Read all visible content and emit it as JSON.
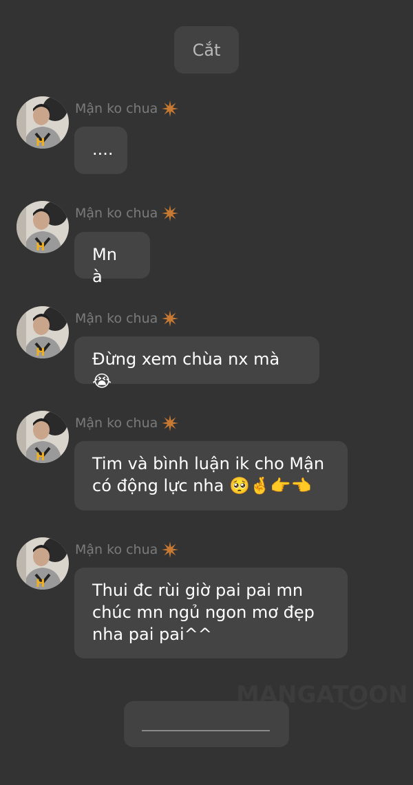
{
  "top_chip": {
    "label": "Cắt"
  },
  "messages": [
    {
      "sender": "Mận ko chua",
      "lines": [
        "...."
      ]
    },
    {
      "sender": "Mận ko chua",
      "lines": [
        "Mn à"
      ]
    },
    {
      "sender": "Mận ko chua",
      "lines": [
        "Đừng xem chùa nx mà 😭"
      ]
    },
    {
      "sender": "Mận ko chua",
      "lines": [
        "Tim và bình luận ik cho Mận",
        "có động lực nha 🥺🤞👉👈"
      ]
    },
    {
      "sender": "Mận ko chua",
      "lines": [
        "Thui đc rùi giờ pai pai mn",
        "chúc mn ngủ ngon mơ đẹp",
        "nha pai pai^^"
      ]
    }
  ],
  "watermark": {
    "text": "MANGATOON"
  },
  "icons": {
    "sender_badge": "star-burst-icon",
    "avatar": "user-avatar"
  },
  "colors": {
    "background": "#333333",
    "bubble": "#444444",
    "sender_text": "#7b7b7b",
    "badge": "#c87a33"
  }
}
